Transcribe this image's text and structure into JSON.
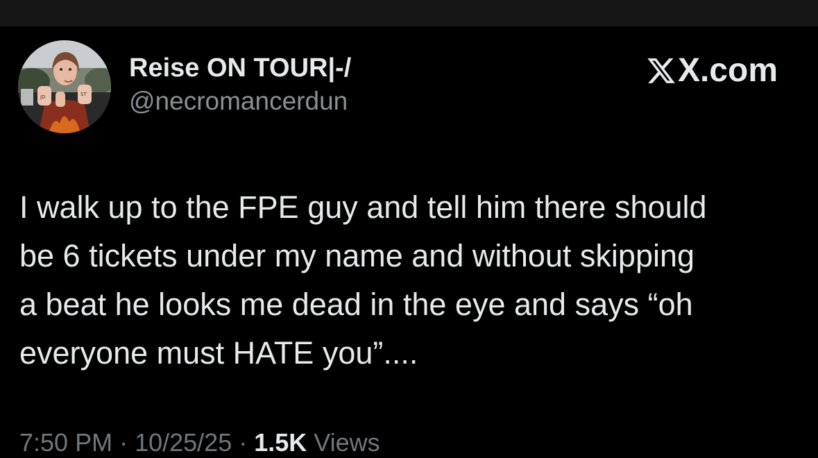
{
  "author": {
    "display_name": "Reise ON TOUR|-/",
    "handle": "@necromancerdun",
    "avatar_icon": "profile-photo"
  },
  "watermark": {
    "text": "X.com",
    "icon": "x-logo-icon"
  },
  "tweet": {
    "lines": [
      "I walk up to the FPE guy and tell him there should",
      "be 6 tickets under my name and without skipping",
      "a beat he looks me dead in the eye and says “oh",
      "everyone must HATE you”...."
    ]
  },
  "meta": {
    "time": "7:50 PM",
    "separator": "·",
    "date": "10/25/25",
    "views_count": "1.5K",
    "views_label": "Views"
  },
  "colors": {
    "background": "#000000",
    "top_strip": "#161616",
    "primary_text": "#e7e9ea",
    "secondary_text": "#8b8f94"
  }
}
